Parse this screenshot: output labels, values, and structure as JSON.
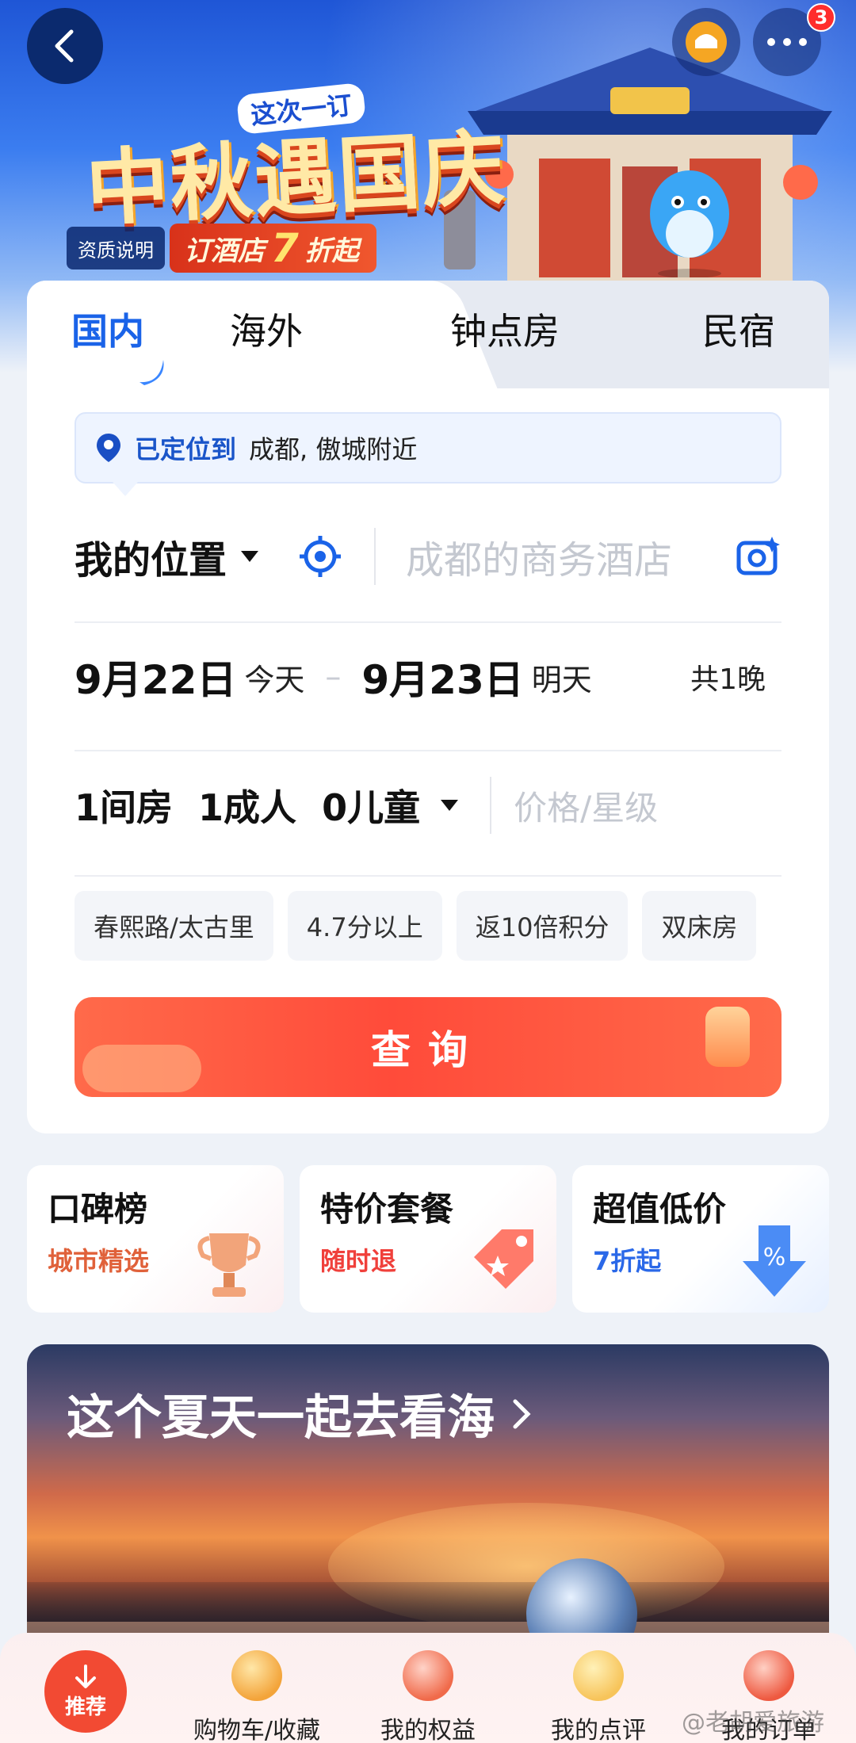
{
  "banner": {
    "promo_sub": "这次一订",
    "promo_title": "中秋遇国庆",
    "qualification_label": "资质说明",
    "discount_prefix": "订酒店",
    "discount_value": "7",
    "discount_suffix": "折起",
    "notification_count": "3"
  },
  "tabs": [
    {
      "label": "国内"
    },
    {
      "label": "海外"
    },
    {
      "label": "钟点房"
    },
    {
      "label": "民宿"
    }
  ],
  "location": {
    "status": "已定位到",
    "city": "成都, 傲城附近"
  },
  "destination": {
    "my_position": "我的位置",
    "search_placeholder": "成都的商务酒店"
  },
  "dates": {
    "checkin": "9月22日",
    "checkin_day": "今天",
    "checkout": "9月23日",
    "checkout_day": "明天",
    "nights": "共1晚"
  },
  "room": {
    "summary": "1间房  1成人  0儿童",
    "price_placeholder": "价格/星级"
  },
  "chips": [
    "春熙路/太古里",
    "4.7分以上",
    "返10倍积分",
    "双床房"
  ],
  "search_button": "查询",
  "quick_cards": [
    {
      "title": "口碑榜",
      "subtitle": "城市精选"
    },
    {
      "title": "特价套餐",
      "subtitle": "随时退"
    },
    {
      "title": "超值低价",
      "subtitle": "7折起"
    }
  ],
  "feature_banner": {
    "title": "这个夏天一起去看海"
  },
  "bottom_nav": {
    "recommend": "推荐",
    "items": [
      "购物车/收藏",
      "我的权益",
      "我的点评",
      "我的订单"
    ]
  },
  "watermark": "@老胡爱旅游",
  "colors": {
    "primary_blue": "#1a63e8",
    "search_red": "#ff4b3a",
    "text_dark": "#111111",
    "placeholder": "#c4c8d0"
  }
}
